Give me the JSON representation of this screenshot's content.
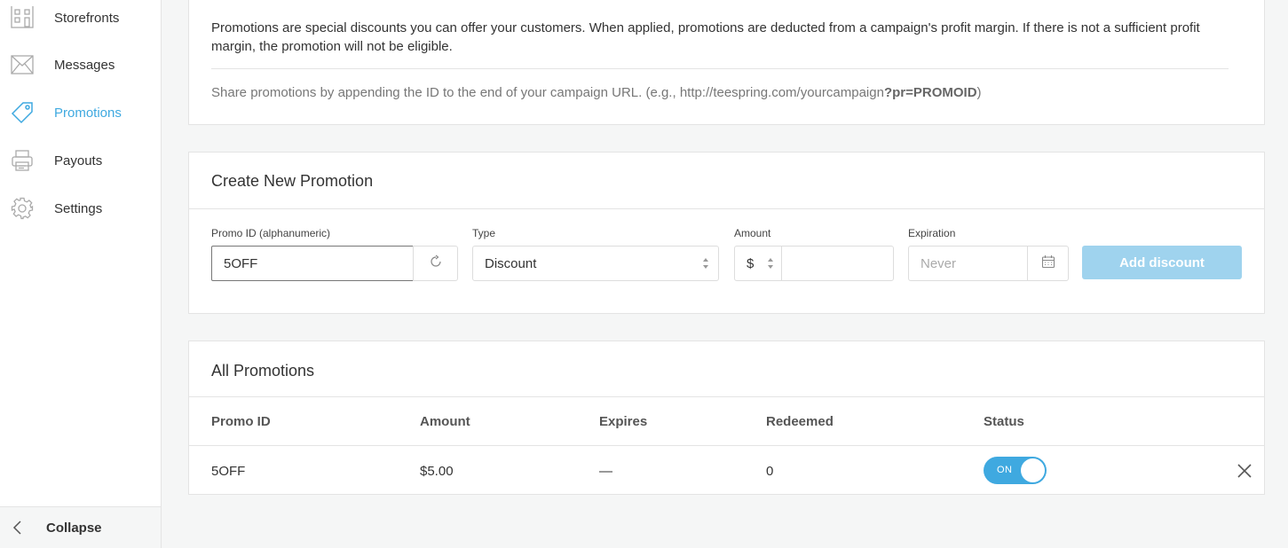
{
  "sidebar": {
    "items": [
      {
        "label": "Storefronts",
        "icon": "storefront-icon"
      },
      {
        "label": "Messages",
        "icon": "envelope-icon"
      },
      {
        "label": "Promotions",
        "icon": "tag-icon",
        "active": true
      },
      {
        "label": "Payouts",
        "icon": "printer-icon"
      },
      {
        "label": "Settings",
        "icon": "gear-icon"
      }
    ],
    "collapse_label": "Collapse"
  },
  "info": {
    "description": "Promotions are special discounts you can offer your customers. When applied, promotions are deducted from a campaign's profit margin. If there is not a sufficient profit margin, the promotion will not be eligible.",
    "share_prefix": "Share promotions by appending the ID to the end of your campaign URL. (e.g., http://teespring.com/yourcampaign",
    "share_param": "?pr=PROMOID",
    "share_suffix": ")"
  },
  "create": {
    "title": "Create New Promotion",
    "promo_id_label": "Promo ID (alphanumeric)",
    "promo_id_value": "5OFF",
    "type_label": "Type",
    "type_value": "Discount",
    "amount_label": "Amount",
    "currency": "$",
    "amount_value": "",
    "expiration_label": "Expiration",
    "expiration_placeholder": "Never",
    "add_button": "Add discount"
  },
  "all": {
    "title": "All Promotions",
    "columns": [
      "Promo ID",
      "Amount",
      "Expires",
      "Redeemed",
      "Status"
    ],
    "rows": [
      {
        "promo_id": "5OFF",
        "amount": "$5.00",
        "expires": "—",
        "redeemed": "0",
        "status": "ON"
      }
    ]
  },
  "colors": {
    "accent": "#3fa9e0",
    "button_disabled": "#9fd3ee"
  }
}
